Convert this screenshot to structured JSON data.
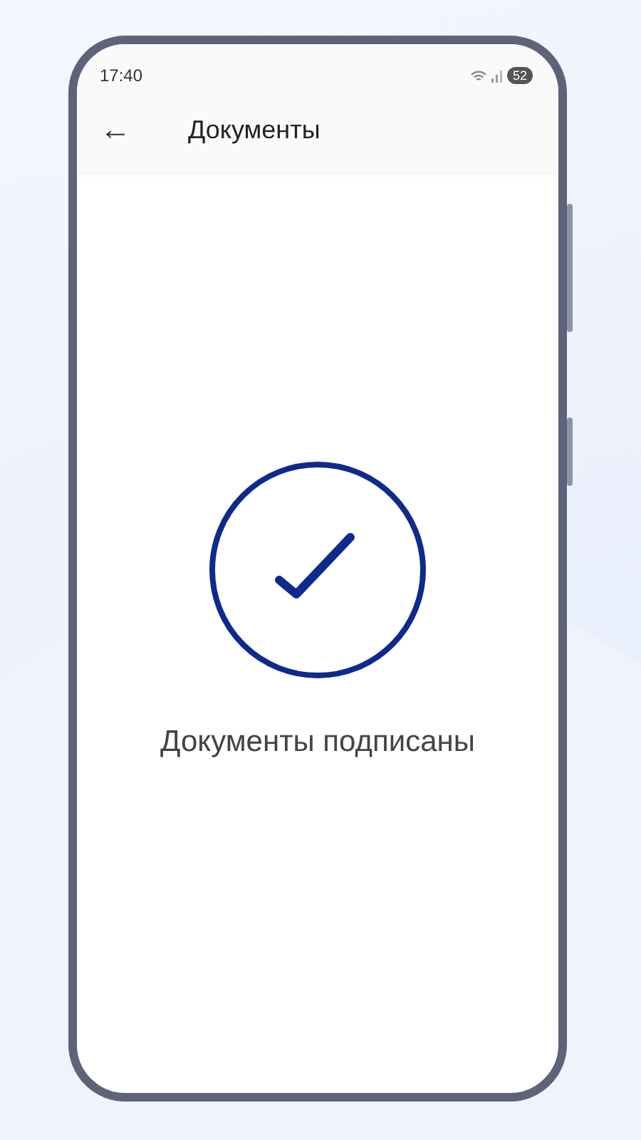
{
  "status_bar": {
    "time": "17:40",
    "battery": "52"
  },
  "app_bar": {
    "back": "←",
    "title": "Документы"
  },
  "message": "Документы подписаны"
}
